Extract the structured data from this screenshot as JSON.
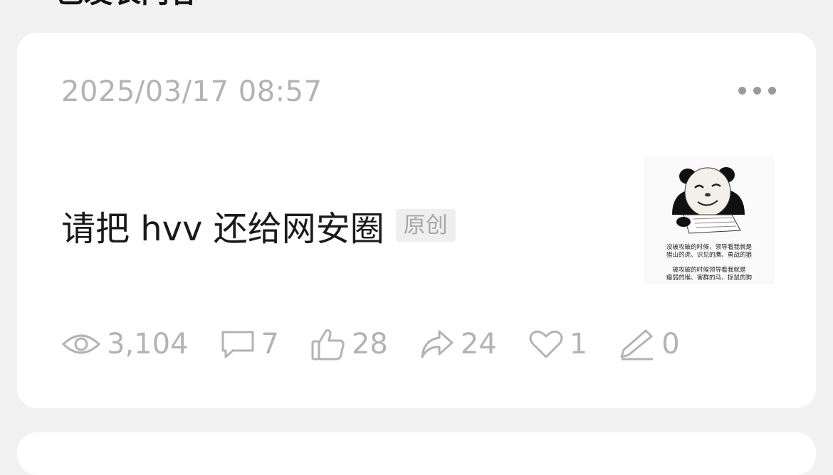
{
  "section": {
    "title_partial": "已发表内容"
  },
  "post": {
    "timestamp": "2025/03/17 08:57",
    "title": "请把 hvv 还给网安圈",
    "badge": "原创",
    "thumbnail": {
      "icon": "panda-meme-image",
      "caption_top_1": "没被攻破的时候，领导看我就是",
      "caption_top_2": "猎山的虎、识见的鹰、勇战的狼",
      "caption_bottom_1": "被攻破的时候领导看我就是",
      "caption_bottom_2": "瘦弱的猴、害群的马、捉鼠的狗"
    },
    "stats": {
      "views": "3,104",
      "comments": "7",
      "likes": "28",
      "shares": "24",
      "favorites": "1",
      "edits": "0"
    }
  },
  "colors": {
    "background": "#f1f1f1",
    "card": "#ffffff",
    "muted_text": "#b3b3b3",
    "title_text": "#1a1a1a",
    "badge_bg": "#efefef"
  }
}
